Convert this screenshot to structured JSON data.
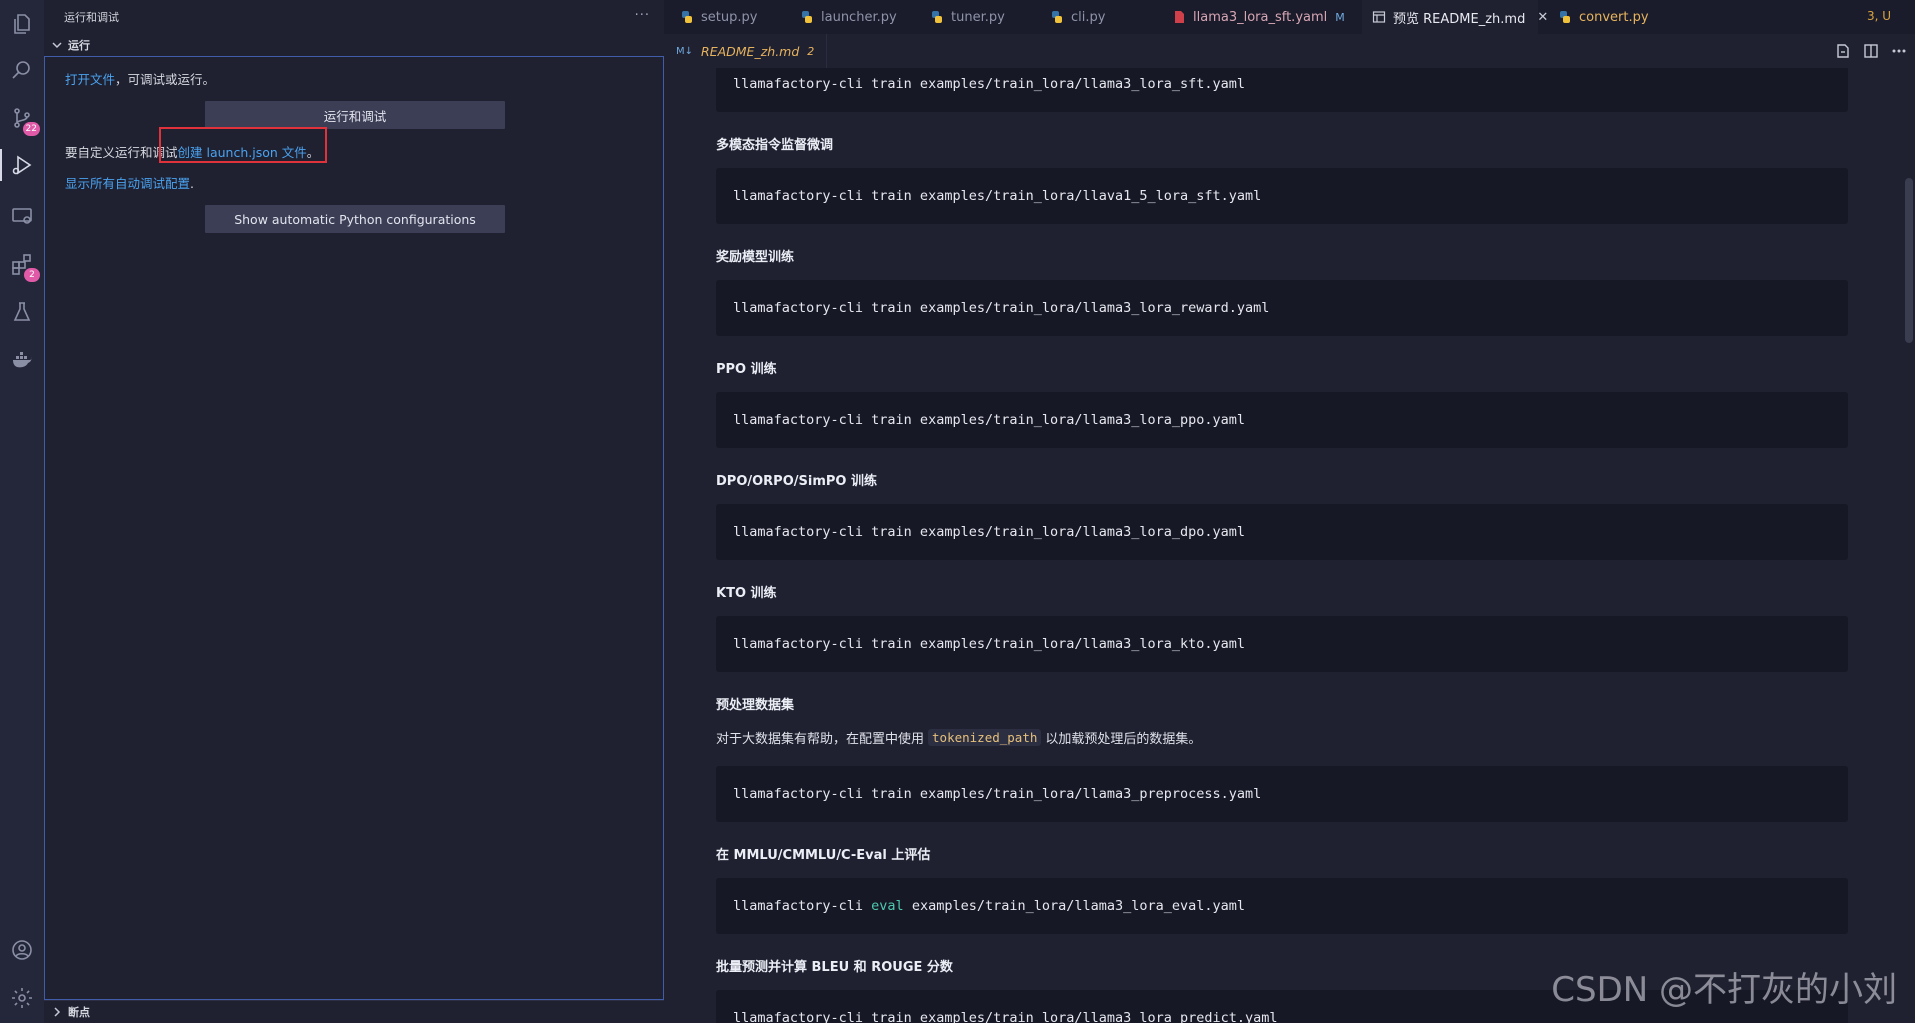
{
  "activity_bar": {
    "scm_badge": "22",
    "extensions_badge": "2"
  },
  "sidebar": {
    "title": "运行和调试",
    "more": "···",
    "section_run": "运行",
    "open_file_link": "打开文件",
    "open_file_rest": "，可调试或运行。",
    "run_debug_button": "运行和调试",
    "customize_prefix": "要自定义运行和调试",
    "create_launch_link": "创建 launch.json 文件",
    "customize_suffix": "。",
    "show_all_link": "显示所有自动调试配置",
    "show_all_suffix": ".",
    "python_config_button": "Show automatic Python configurations",
    "section_breakpoints": "断点"
  },
  "tabs": [
    {
      "label": "setup.py",
      "icon": "python-icon"
    },
    {
      "label": "launcher.py",
      "icon": "python-icon"
    },
    {
      "label": "tuner.py",
      "icon": "python-icon"
    },
    {
      "label": "cli.py",
      "icon": "python-icon"
    },
    {
      "label": "llama3_lora_sft.yaml",
      "icon": "yaml-icon",
      "modified": "M"
    },
    {
      "label": "预览 README_zh.md",
      "icon": "preview-icon",
      "close": "✕"
    },
    {
      "label": "convert.py",
      "icon": "python-icon"
    }
  ],
  "tab_overflow": "3, U",
  "breadcrumb": {
    "file": "README_zh.md",
    "problems": "2"
  },
  "document": {
    "items": [
      {
        "kind": "code",
        "text": "llamafactory-cli train examples/train_lora/llama3_lora_sft.yaml"
      },
      {
        "kind": "heading",
        "text": "多模态指令监督微调"
      },
      {
        "kind": "code",
        "text": "llamafactory-cli train examples/train_lora/llava1_5_lora_sft.yaml"
      },
      {
        "kind": "heading",
        "text": "奖励模型训练"
      },
      {
        "kind": "code",
        "text": "llamafactory-cli train examples/train_lora/llama3_lora_reward.yaml"
      },
      {
        "kind": "heading",
        "text": "PPO 训练"
      },
      {
        "kind": "code",
        "text": "llamafactory-cli train examples/train_lora/llama3_lora_ppo.yaml"
      },
      {
        "kind": "heading",
        "text": "DPO/ORPO/SimPO 训练"
      },
      {
        "kind": "code",
        "text": "llamafactory-cli train examples/train_lora/llama3_lora_dpo.yaml"
      },
      {
        "kind": "heading",
        "text": "KTO 训练"
      },
      {
        "kind": "code",
        "text": "llamafactory-cli train examples/train_lora/llama3_lora_kto.yaml"
      },
      {
        "kind": "heading",
        "text": "预处理数据集"
      },
      {
        "kind": "para",
        "before": "对于大数据集有帮助，在配置中使用",
        "code": "tokenized_path",
        "after": "以加载预处理后的数据集。"
      },
      {
        "kind": "code",
        "text": "llamafactory-cli train examples/train_lora/llama3_preprocess.yaml"
      },
      {
        "kind": "heading",
        "text": "在 MMLU/CMMLU/C-Eval 上评估"
      },
      {
        "kind": "code_kw",
        "pre": "llamafactory-cli ",
        "kw": "eval",
        "post": " examples/train_lora/llama3_lora_eval.yaml"
      },
      {
        "kind": "heading",
        "text": "批量预测并计算 BLEU 和 ROUGE 分数"
      },
      {
        "kind": "code",
        "text": "llamafactory-cli train examples/train_lora/llama3_lora_predict.yaml"
      }
    ]
  },
  "watermark": "CSDN @不打灰的小刘",
  "colors": {
    "link": "#4aa3f0",
    "highlight_box": "#e0323a",
    "badge": "#e05aa8",
    "keyword": "#4ec9b0",
    "inline_code": "#e6c07b"
  }
}
